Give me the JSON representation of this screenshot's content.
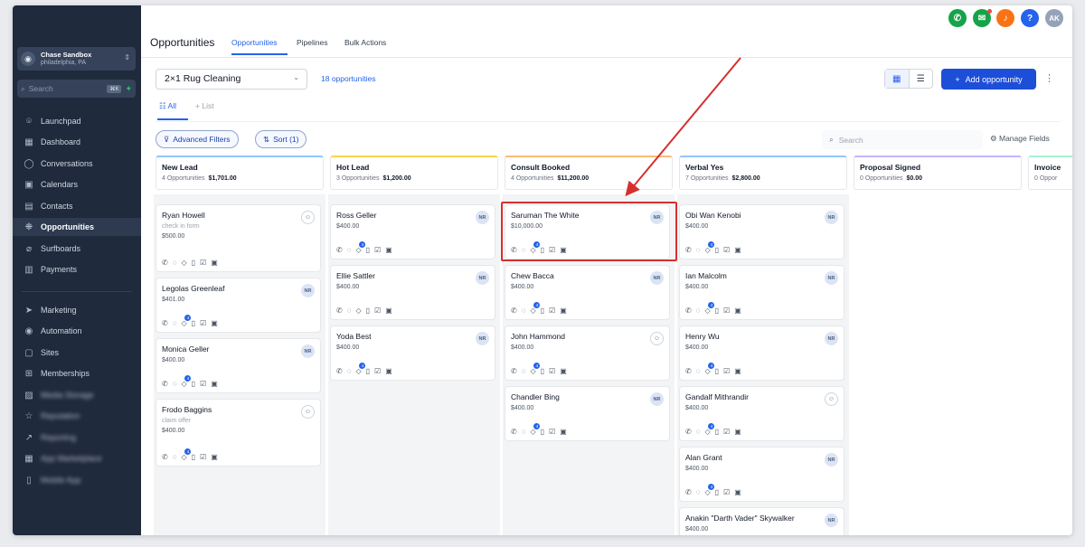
{
  "account": {
    "name": "Chase Sandbox",
    "location": "philadelphia, PA"
  },
  "search": {
    "placeholder": "Search",
    "shortcut": "⌘K"
  },
  "sidebar": {
    "items": [
      {
        "label": "Launchpad",
        "icon": "rocket-icon"
      },
      {
        "label": "Dashboard",
        "icon": "grid-icon"
      },
      {
        "label": "Conversations",
        "icon": "chat-icon"
      },
      {
        "label": "Calendars",
        "icon": "calendar-icon"
      },
      {
        "label": "Contacts",
        "icon": "contacts-icon"
      },
      {
        "label": "Opportunities",
        "icon": "opportunities-icon"
      },
      {
        "label": "Surfboards",
        "icon": "surfboard-icon"
      },
      {
        "label": "Payments",
        "icon": "payments-icon"
      },
      {
        "label": "Marketing",
        "icon": "send-icon"
      },
      {
        "label": "Automation",
        "icon": "automation-icon"
      },
      {
        "label": "Sites",
        "icon": "sites-icon"
      },
      {
        "label": "Memberships",
        "icon": "memberships-icon"
      },
      {
        "label": "Media Storage",
        "icon": "image-icon"
      },
      {
        "label": "Reputation",
        "icon": "star-icon"
      },
      {
        "label": "Reporting",
        "icon": "trend-icon"
      },
      {
        "label": "App Marketplace",
        "icon": "apps-icon"
      },
      {
        "label": "Mobile App",
        "icon": "mobile-icon"
      }
    ]
  },
  "header": {
    "title": "Opportunities",
    "tabs": [
      "Opportunities",
      "Pipelines",
      "Bulk Actions"
    ],
    "avatar": "AK"
  },
  "toolbar": {
    "pipeline": "2×1 Rug Cleaning",
    "count": "18 opportunities",
    "add_label": "Add opportunity",
    "view_all": "All",
    "view_list": "List",
    "filters": "Advanced Filters",
    "sort": "Sort (1)",
    "search_placeholder": "Search",
    "manage_fields": "Manage Fields"
  },
  "columns": [
    {
      "name": "New Lead",
      "count": "4 Opportunities",
      "total": "$1,701.00",
      "accent": "#93c5fd"
    },
    {
      "name": "Hot Lead",
      "count": "3 Opportunities",
      "total": "$1,200.00",
      "accent": "#fcd34d"
    },
    {
      "name": "Consult Booked",
      "count": "4 Opportunities",
      "total": "$11,200.00",
      "accent": "#fdba74"
    },
    {
      "name": "Verbal Yes",
      "count": "7 Opportunities",
      "total": "$2,800.00",
      "accent": "#93c5fd"
    },
    {
      "name": "Proposal Signed",
      "count": "0 Opportunities",
      "total": "$0.00",
      "accent": "#c4b5fd"
    },
    {
      "name": "Invoice",
      "count": "0 Oppor",
      "total": "",
      "accent": "#a7f3d0"
    }
  ],
  "cards": [
    [
      {
        "name": "Ryan Howell",
        "sub": "check in form",
        "value": "$500.00",
        "badge": "user"
      },
      {
        "name": "Legolas Greenleaf",
        "sub": "",
        "value": "$401.00",
        "badge": "NR",
        "cnt": "4"
      },
      {
        "name": "Monica Geller",
        "sub": "",
        "value": "$400.00",
        "badge": "NR",
        "cnt": "4"
      },
      {
        "name": "Frodo Baggins",
        "sub": "claim offer",
        "value": "$400.00",
        "badge": "user",
        "cnt": "4"
      }
    ],
    [
      {
        "name": "Ross Geller",
        "sub": "",
        "value": "$400.00",
        "badge": "NR",
        "cnt": "4"
      },
      {
        "name": "Ellie Sattler",
        "sub": "",
        "value": "$400.00",
        "badge": "NR"
      },
      {
        "name": "Yoda Best",
        "sub": "",
        "value": "$400.00",
        "badge": "NR",
        "cnt": "4"
      }
    ],
    [
      {
        "name": "Saruman The White",
        "sub": "",
        "value": "$10,000.00",
        "badge": "NR",
        "cnt": "4"
      },
      {
        "name": "Chew Bacca",
        "sub": "",
        "value": "$400.00",
        "badge": "NR",
        "cnt": "4"
      },
      {
        "name": "John Hammond",
        "sub": "",
        "value": "$400.00",
        "badge": "user",
        "cnt": "4"
      },
      {
        "name": "Chandler Bing",
        "sub": "",
        "value": "$400.00",
        "badge": "NR",
        "cnt": "4"
      }
    ],
    [
      {
        "name": "Obi Wan Kenobi",
        "sub": "",
        "value": "$400.00",
        "badge": "NR",
        "cnt": "4"
      },
      {
        "name": "Ian Malcolm",
        "sub": "",
        "value": "$400.00",
        "badge": "NR",
        "cnt": "4"
      },
      {
        "name": "Henry Wu",
        "sub": "",
        "value": "$400.00",
        "badge": "NR",
        "cnt": "4"
      },
      {
        "name": "Gandalf Mithrandir",
        "sub": "",
        "value": "$400.00",
        "badge": "user",
        "cnt": "4"
      },
      {
        "name": "Alan Grant",
        "sub": "",
        "value": "$400.00",
        "badge": "NR",
        "cnt": "4"
      },
      {
        "name": "Anakin \"Darth Vader\" Skywalker",
        "sub": "",
        "value": "$400.00",
        "badge": "NR"
      }
    ]
  ],
  "colors": {
    "brand": "#1d4ed8",
    "annotation": "#d62f2f"
  }
}
